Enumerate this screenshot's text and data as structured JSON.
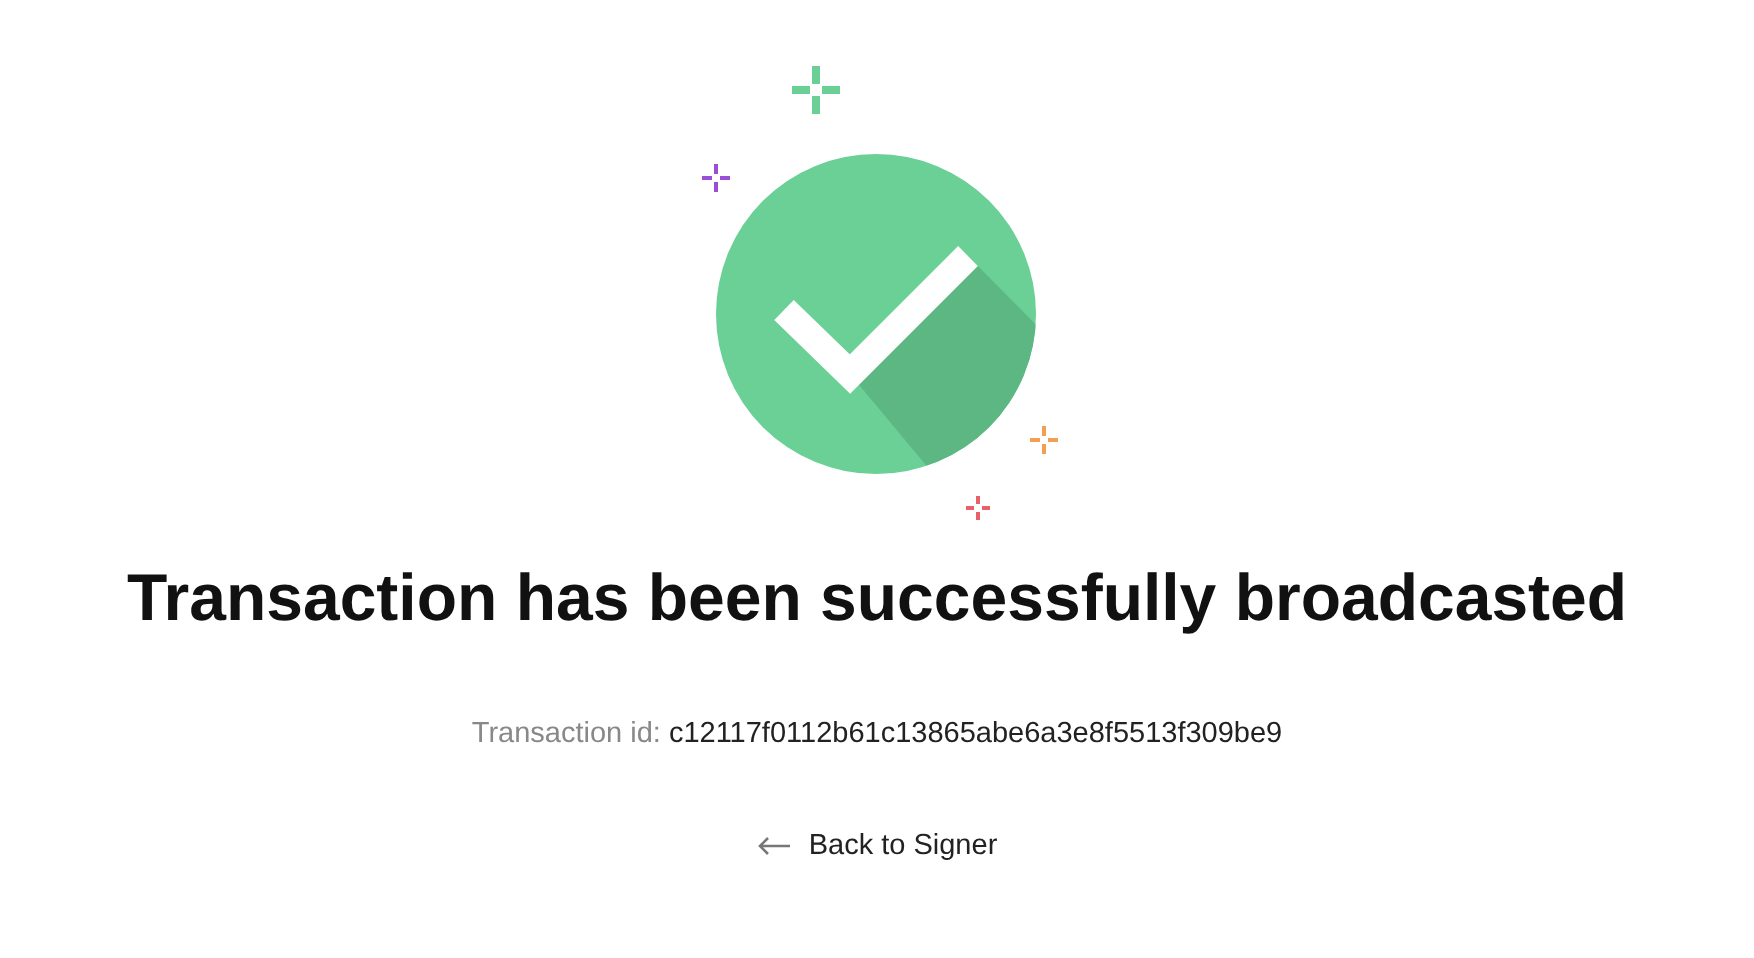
{
  "title": "Transaction has been successfully broadcasted",
  "transaction": {
    "label": "Transaction id:",
    "value": "c12117f0112b61c13865abe6a3e8f5513f309be9"
  },
  "back_link": {
    "label": "Back to Signer"
  }
}
